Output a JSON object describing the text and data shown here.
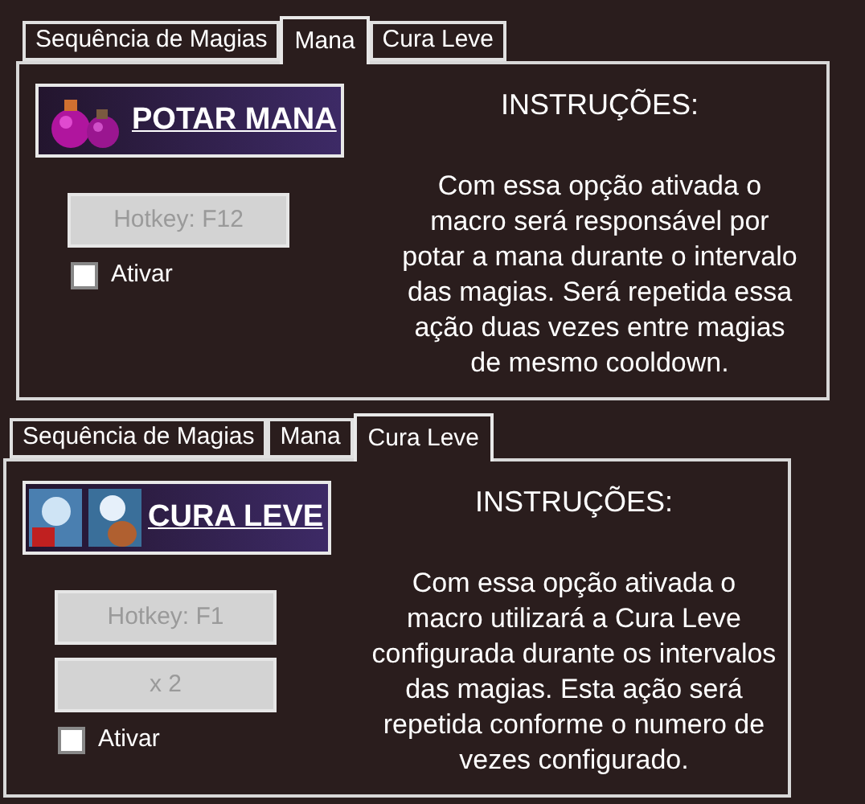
{
  "panels": [
    {
      "tabs": [
        {
          "label": "Sequência de Magias",
          "selected": false
        },
        {
          "label": "Mana",
          "selected": true
        },
        {
          "label": "Cura Leve",
          "selected": false
        }
      ],
      "header": {
        "title": "POTAR MANA",
        "kind": "potion"
      },
      "buttons": [
        "Hotkey: F12"
      ],
      "checkbox": {
        "label": "Ativar",
        "checked": false
      },
      "instructions": {
        "title": "INSTRUÇÕES:",
        "lines": [
          "Com essa opção ativada o",
          "macro será responsável por",
          "potar a mana durante o intervalo",
          "das magias. Será repetida essa",
          "ação duas vezes entre magias",
          "de mesmo cooldown."
        ]
      }
    },
    {
      "tabs": [
        {
          "label": "Sequência de Magias",
          "selected": false
        },
        {
          "label": "Mana",
          "selected": false
        },
        {
          "label": "Cura Leve",
          "selected": true
        }
      ],
      "header": {
        "title": "CURA LEVE",
        "kind": "spell"
      },
      "buttons": [
        "Hotkey: F1",
        "x 2"
      ],
      "checkbox": {
        "label": "Ativar",
        "checked": false
      },
      "instructions": {
        "title": "INSTRUÇÕES:",
        "lines": [
          "Com essa opção ativada o",
          "macro utilizará a Cura Leve",
          "configurada durante os intervalos",
          "das magias. Esta ação será",
          "repetida conforme o numero de",
          "vezes configurado."
        ]
      }
    }
  ]
}
